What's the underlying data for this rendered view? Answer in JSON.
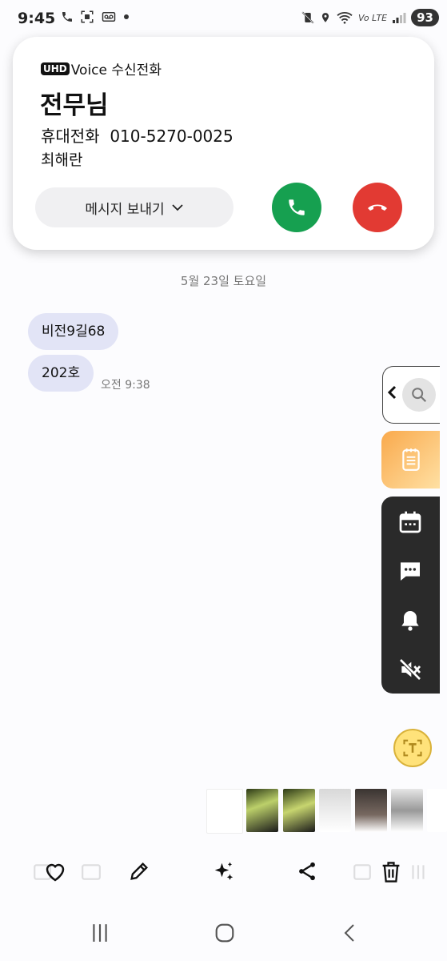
{
  "status_bar": {
    "time": "9:45",
    "battery": "93",
    "network": "Vo LTE"
  },
  "call_card": {
    "badge": "UHD",
    "call_type": "Voice 수신전화",
    "caller_name": "전무님",
    "phone_label": "휴대전화",
    "phone_number": "010-5270-0025",
    "caller_subtitle": "최해란",
    "send_message_label": "메시지 보내기",
    "accept_color": "#16a050",
    "decline_color": "#e23a33"
  },
  "conversation": {
    "date_header": "5월 23일 토요일",
    "messages": [
      {
        "text": "비전9길68"
      },
      {
        "text": "202호",
        "time": "오전 9:38"
      }
    ]
  },
  "edge_panel": {
    "items": [
      "search-icon",
      "notes-icon",
      "calendar-icon",
      "chat-icon",
      "bell-icon",
      "mute-icon"
    ]
  },
  "toolbar": {
    "items": [
      "heart-icon",
      "edit-icon",
      "ai-sparkle-icon",
      "share-icon",
      "trash-icon"
    ]
  },
  "navbar": {
    "items": [
      "recents-icon",
      "home-icon",
      "back-icon"
    ]
  }
}
